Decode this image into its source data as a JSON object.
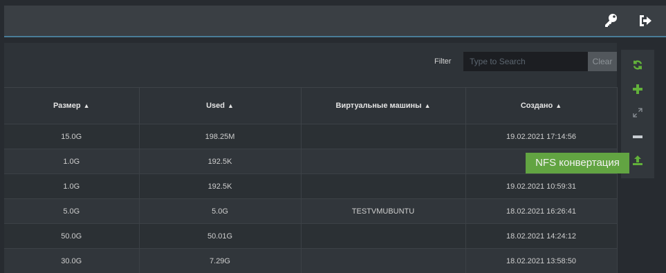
{
  "header": {
    "key_icon": "key-icon",
    "logout_icon": "logout-icon"
  },
  "filter": {
    "label": "Filter",
    "placeholder": "Type to Search",
    "clear_label": "Clear"
  },
  "table": {
    "columns": [
      {
        "label": "Размер"
      },
      {
        "label": "Used"
      },
      {
        "label": "Виртуальные машины"
      },
      {
        "label": "Создано"
      }
    ],
    "rows": [
      {
        "size": "15.0G",
        "used": "198.25M",
        "vms": "",
        "created": "19.02.2021 17:14:56"
      },
      {
        "size": "1.0G",
        "used": "192.5K",
        "vms": "",
        "created": "19.02.2"
      },
      {
        "size": "1.0G",
        "used": "192.5K",
        "vms": "",
        "created": "19.02.2021 10:59:31"
      },
      {
        "size": "5.0G",
        "used": "5.0G",
        "vms": "TESTVMUBUNTU",
        "created": "18.02.2021 16:26:41"
      },
      {
        "size": "50.0G",
        "used": "50.01G",
        "vms": "",
        "created": "18.02.2021 14:24:12"
      },
      {
        "size": "30.0G",
        "used": "7.29G",
        "vms": "",
        "created": "18.02.2021 13:58:50"
      }
    ]
  },
  "toolbar": {
    "buttons": [
      {
        "name": "refresh-icon",
        "color": "#62b13a"
      },
      {
        "name": "plus-icon",
        "color": "#62b13a"
      },
      {
        "name": "resize-icon",
        "color": "#8a9096"
      },
      {
        "name": "minus-icon",
        "color": "#c8cdd2"
      },
      {
        "name": "upload-icon",
        "color": "#62b13a"
      }
    ]
  },
  "tooltip": {
    "text": "NFS конвертация",
    "color": "#62a442"
  }
}
